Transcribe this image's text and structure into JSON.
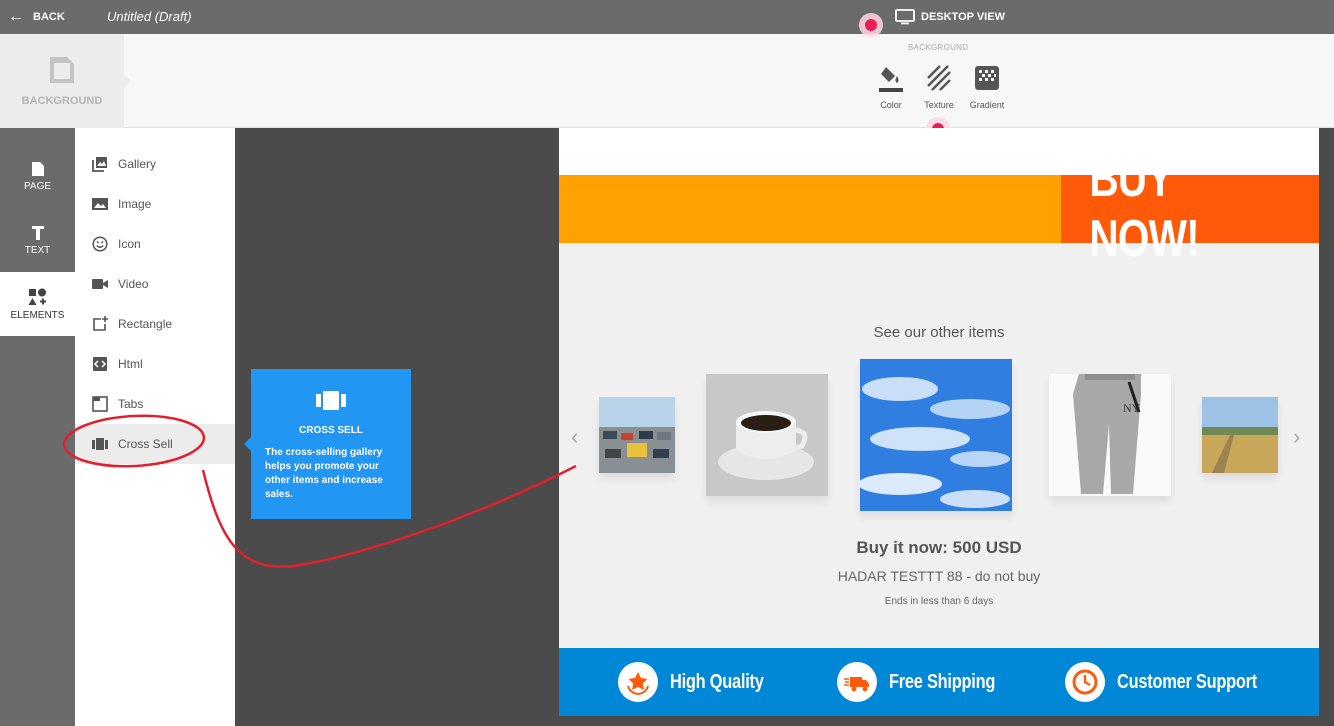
{
  "topbar": {
    "back_label": "BACK",
    "doc_title": "Untitled (Draft)",
    "view_label": "DESKTOP VIEW"
  },
  "background_bar": {
    "tab_label": "BACKGROUND",
    "heading": "BACKGROUND",
    "tools": [
      {
        "label": "Color",
        "icon": "paint-bucket-icon"
      },
      {
        "label": "Texture",
        "icon": "texture-stripes-icon"
      },
      {
        "label": "Gradient",
        "icon": "gradient-icon"
      }
    ]
  },
  "rail": {
    "items": [
      {
        "label": "PAGE",
        "icon": "page-icon"
      },
      {
        "label": "TEXT",
        "icon": "text-icon"
      },
      {
        "label": "ELEMENTS",
        "icon": "shapes-icon",
        "active": true
      }
    ]
  },
  "elements": {
    "items": [
      {
        "label": "Gallery",
        "icon": "gallery-icon"
      },
      {
        "label": "Image",
        "icon": "image-icon"
      },
      {
        "label": "Icon",
        "icon": "smiley-icon"
      },
      {
        "label": "Video",
        "icon": "video-camera-icon"
      },
      {
        "label": "Rectangle",
        "icon": "rectangle-add-icon"
      },
      {
        "label": "Html",
        "icon": "code-icon"
      },
      {
        "label": "Tabs",
        "icon": "tabs-icon"
      },
      {
        "label": "Cross Sell",
        "icon": "carousel-icon",
        "active": true
      }
    ]
  },
  "tooltip": {
    "title": "CROSS SELL",
    "text": "The cross-selling gallery helps you promote your other items and increase sales."
  },
  "canvas": {
    "buy_button": "BUY NOW!",
    "gallery_heading": "See our other items",
    "price": "Buy it now: 500 USD",
    "product_name": "HADAR TESTTT 88 - do not buy",
    "ends": "Ends in less than 6 days",
    "features": [
      {
        "label": "High Quality",
        "icon": "medal-star-icon"
      },
      {
        "label": "Free Shipping",
        "icon": "fast-truck-icon"
      },
      {
        "label": "Customer Support",
        "icon": "clock-icon"
      }
    ]
  },
  "colors": {
    "accent_blue": "#2196f3",
    "banner_orange": "#ffa100",
    "buy_button_orange": "#ff5a0a",
    "footer_blue": "#0088d6",
    "hotspot_pink": "#e91e56",
    "annotation_red": "#e0202e"
  }
}
